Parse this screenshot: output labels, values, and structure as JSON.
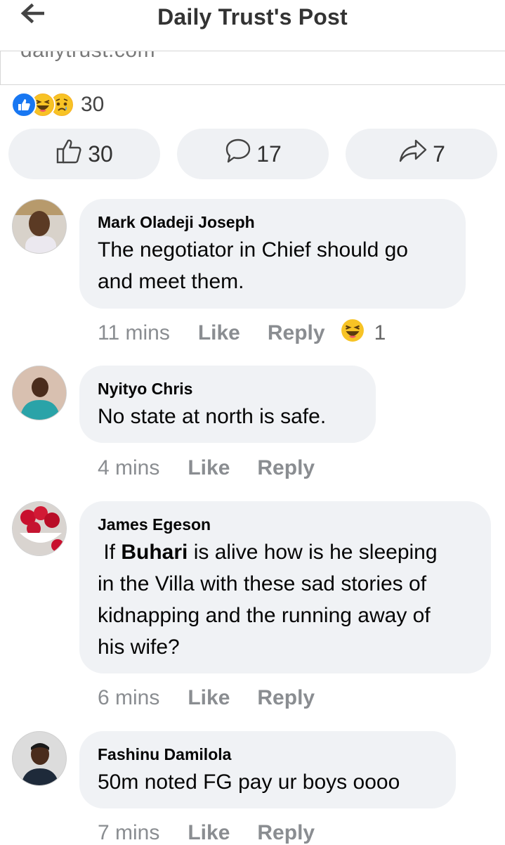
{
  "header": {
    "title": "Daily Trust's Post"
  },
  "link_preview": {
    "domain": "dailytrust.com"
  },
  "reactions": {
    "icons": [
      "like-icon",
      "haha-icon",
      "sad-icon"
    ],
    "count": "30"
  },
  "actions": {
    "like": {
      "count": "30",
      "icon": "thumbs-up-icon"
    },
    "comment": {
      "count": "17",
      "icon": "comment-icon"
    },
    "share": {
      "count": "7",
      "icon": "share-icon"
    }
  },
  "comments": [
    {
      "name": "Mark Oladeji Joseph",
      "lines": [
        "The negotiator in Chief should go",
        "and meet them."
      ],
      "time": "11 mins",
      "like": "Like",
      "reply": "Reply",
      "reaction_icon": "haha-icon",
      "reaction_count": "1"
    },
    {
      "name": "Nyityo Chris",
      "lines": [
        "No state at north is safe."
      ],
      "time": "4 mins",
      "like": "Like",
      "reply": "Reply"
    },
    {
      "name": "James Egeson",
      "pre": " If ",
      "bold": "Buhari",
      "post": " is alive how is he sleeping",
      "lines": [
        "in the Villa with these sad stories of",
        "kidnapping and the running away of",
        "his wife?"
      ],
      "time": "6 mins",
      "like": "Like",
      "reply": "Reply"
    },
    {
      "name": "Fashinu Damilola",
      "lines": [
        "50m noted FG pay ur boys oooo"
      ],
      "time": "7 mins",
      "like": "Like",
      "reply": "Reply"
    }
  ],
  "colors": {
    "like_blue": "#1877f2",
    "haha_yellow": "#f7b125",
    "bubble_bg": "#f0f2f5",
    "button_bg": "#eff1f4",
    "meta_grey": "#8a8d91"
  }
}
